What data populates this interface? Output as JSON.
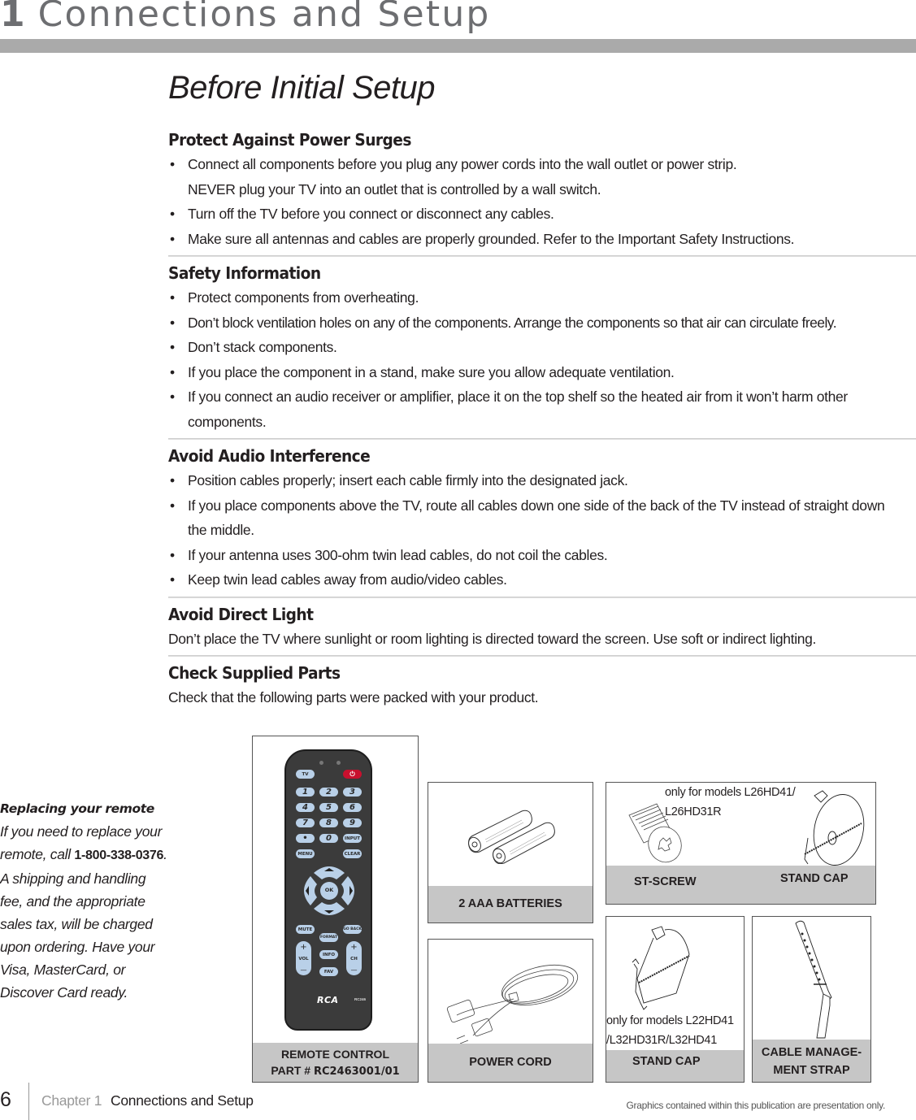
{
  "chapter": {
    "number": "1",
    "title": "Connections and Setup"
  },
  "section_title": "Before Initial Setup",
  "sections": [
    {
      "heading": "Protect Against Power Surges",
      "bullets": [
        "Connect all components before you plug any power cords into the wall outlet or power strip.\nNEVER plug your TV into an outlet that is controlled by a wall switch.",
        "Turn off the TV before you connect or disconnect any cables.",
        "Make sure all antennas and cables are properly grounded. Refer to the Important Safety Instructions."
      ]
    },
    {
      "heading": "Safety Information",
      "bullets": [
        "Protect components from overheating.",
        "Don’t block ventilation holes on any of the components. Arrange the components so that air can circulate freely.",
        "Don’t stack components.",
        "If you place the component in a stand, make sure you allow adequate ventilation.",
        "If you connect an audio receiver or amplifier, place it on the top shelf so the heated air from it won’t harm other components."
      ]
    },
    {
      "heading": "Avoid Audio Interference",
      "bullets": [
        "Position cables properly; insert each cable firmly into the designated jack.",
        "If you place components above the TV, route all cables down one side of the back of the TV instead of straight down the middle.",
        "If your antenna uses 300-ohm twin lead cables, do not coil the cables.",
        "Keep twin lead cables away from audio/video cables."
      ]
    },
    {
      "heading": "Avoid Direct Light",
      "text": "Don’t place the TV where sunlight or room lighting is directed toward the screen. Use soft or indirect lighting."
    },
    {
      "heading": "Check Supplied Parts",
      "text": "Check that the following parts were packed with your product."
    }
  ],
  "sidebar_note": {
    "heading": "Replacing your remote",
    "text_before_phone": "If you need to replace your remote, call",
    "phone": "1-800-338-0376",
    "text_after_phone": ".  A shipping and handling fee, and the appropriate sales tax, will be charged upon ordering.  Have your Visa, MasterCard, or Discover Card ready."
  },
  "parts": {
    "remote": {
      "label_line1": "REMOTE CONTROL",
      "label_prefix": "PART # ",
      "part_number": "RC2463001/01",
      "buttons": {
        "tv": "TV",
        "power": "⏻",
        "digits": [
          "1",
          "2",
          "3",
          "4",
          "5",
          "6",
          "7",
          "8",
          "9"
        ],
        "dot": "•",
        "zero": "0",
        "input": "INPUT",
        "menu": "MENU",
        "clear": "CLEAR",
        "ok": "OK",
        "mute": "MUTE",
        "goback": "GO BACK",
        "format": "FORMAT",
        "info": "INFO",
        "fav": "FAV",
        "vol": "VOL",
        "ch": "CH",
        "plus": "+",
        "minus": "—"
      },
      "brand": "RCA",
      "model": "RC246"
    },
    "batteries": {
      "label": "2 AAA BATTERIES"
    },
    "screw_cap": {
      "note_line1": "only for models L26HD41/",
      "note_line2": "L26HD31R",
      "screw_label": "ST-SCREW",
      "cap_label": "STAND CAP"
    },
    "power_cord": {
      "label": "POWER CORD"
    },
    "stand_cap2": {
      "note_line1": "only for models L22HD41",
      "note_line2": "/L32HD31R/L32HD41",
      "label": "STAND CAP"
    },
    "cable_strap": {
      "label_line1": "CABLE MANAGE-",
      "label_line2": "MENT STRAP"
    }
  },
  "footer": {
    "page_number": "6",
    "chapter_label": "Chapter 1",
    "chapter_title": "Connections and Setup",
    "disclaimer": "Graphics contained within this publication are presentation only."
  }
}
